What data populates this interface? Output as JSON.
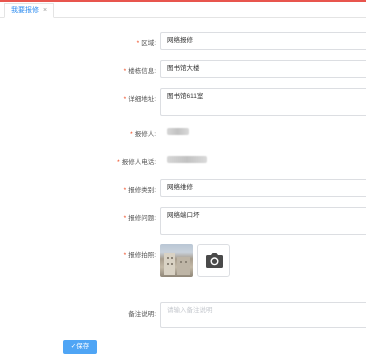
{
  "tab": {
    "label": "我要报修",
    "close": "×"
  },
  "form": {
    "region": {
      "label": "区域:",
      "value": "网络报修"
    },
    "building": {
      "label": "楼栋信息:",
      "value": "图书馆大楼"
    },
    "address": {
      "label": "详细地址:",
      "value": "图书馆611室"
    },
    "reporter": {
      "label": "报修人:"
    },
    "phone": {
      "label": "报修人电话:"
    },
    "category": {
      "label": "报修类别:",
      "value": "网络维修"
    },
    "problem": {
      "label": "报修问题:",
      "value": "网络端口坏"
    },
    "photo": {
      "label": "报修拍照:"
    },
    "remark": {
      "label": "备注说明:",
      "placeholder": "请输入备注说明"
    },
    "required_mark": "*"
  },
  "icons": {
    "upload": "camera-icon",
    "tab_close": "close-icon",
    "save": "check-icon"
  },
  "save_button": {
    "label": "✓保存"
  },
  "colors": {
    "accent": "#2d8cf0",
    "button": "#4fa5f5",
    "required": "#ed4014",
    "top_bar": "#e8554e"
  }
}
